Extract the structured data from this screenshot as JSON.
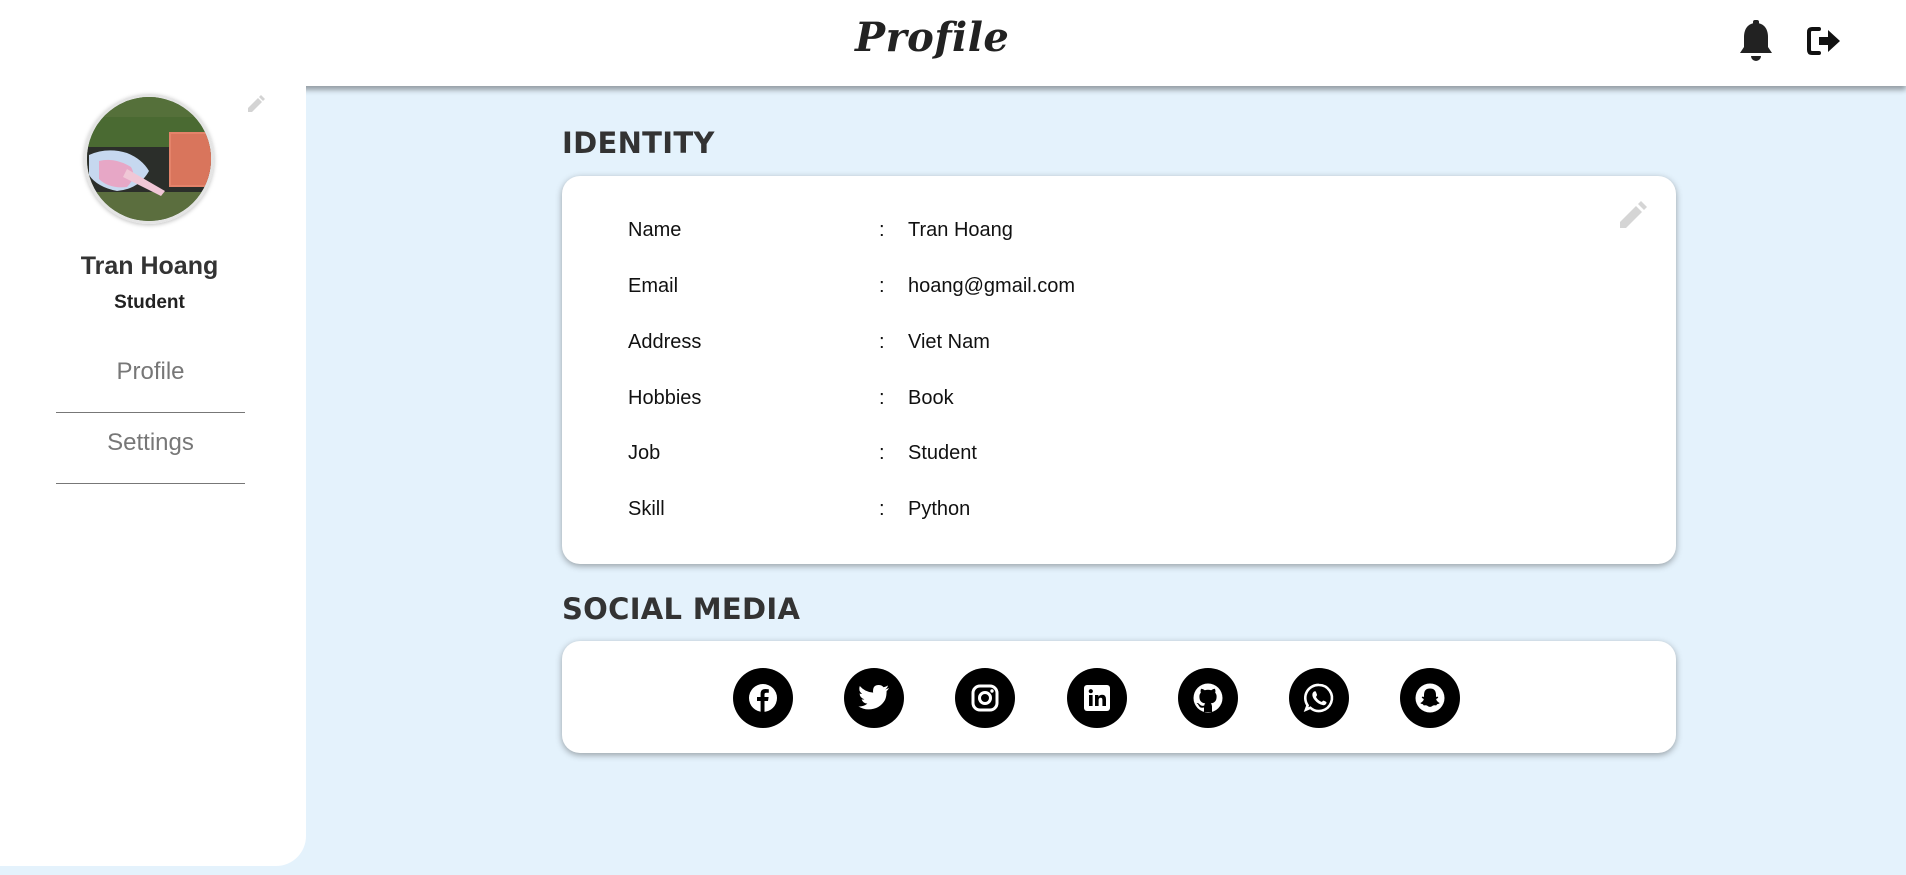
{
  "header": {
    "title": "Profile",
    "icons": {
      "notification": "bell-icon",
      "logout": "sign-out-icon"
    }
  },
  "sidebar": {
    "user_name": "Tran Hoang",
    "user_role": "Student",
    "nav": [
      {
        "label": "Profile"
      },
      {
        "label": "Settings"
      }
    ]
  },
  "identity": {
    "heading": "IDENTITY",
    "rows": [
      {
        "label": "Name",
        "sep": ":",
        "value": "Tran Hoang"
      },
      {
        "label": "Email",
        "sep": ":",
        "value": "hoang@gmail.com"
      },
      {
        "label": "Address",
        "sep": ":",
        "value": "Viet Nam"
      },
      {
        "label": "Hobbies",
        "sep": ":",
        "value": "Book"
      },
      {
        "label": "Job",
        "sep": ":",
        "value": "Student"
      },
      {
        "label": "Skill",
        "sep": ":",
        "value": "Python"
      }
    ]
  },
  "social": {
    "heading": "SOCIAL MEDIA",
    "icons": [
      "facebook-icon",
      "twitter-icon",
      "instagram-icon",
      "linkedin-icon",
      "github-icon",
      "whatsapp-icon",
      "snapchat-icon"
    ]
  },
  "colors": {
    "page_background": "#e4f2fc",
    "panel_background": "#ffffff",
    "text_dark": "#333333",
    "nav_text": "#777777",
    "icon_circle": "#000000"
  }
}
